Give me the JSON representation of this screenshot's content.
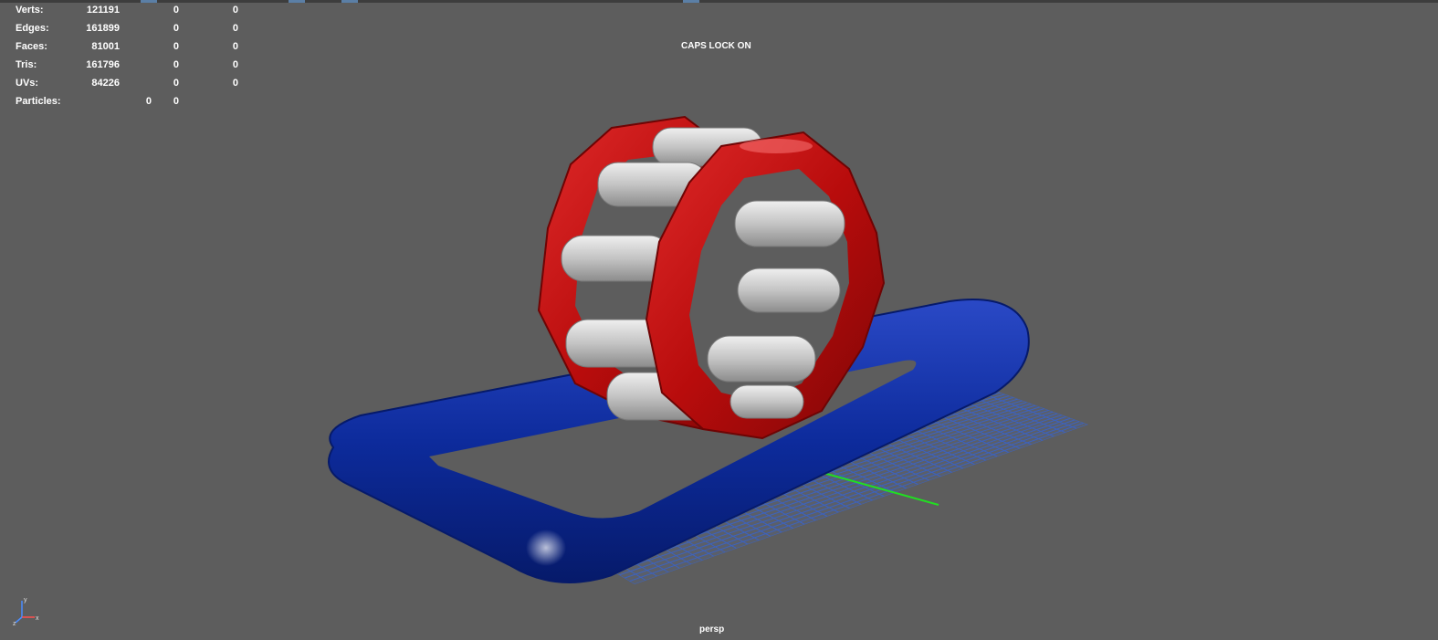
{
  "hud": {
    "stats": [
      {
        "label": "Verts:",
        "values": [
          "121191",
          "0",
          "0"
        ]
      },
      {
        "label": "Edges:",
        "values": [
          "161899",
          "0",
          "0"
        ]
      },
      {
        "label": "Faces:",
        "values": [
          "81001",
          "0",
          "0"
        ]
      },
      {
        "label": "Tris:",
        "values": [
          "161796",
          "0",
          "0"
        ]
      },
      {
        "label": "UVs:",
        "values": [
          "84226",
          "0",
          "0"
        ]
      }
    ],
    "particles": {
      "label": "Particles:",
      "values": [
        "0",
        "0"
      ]
    }
  },
  "caps_lock": "CAPS LOCK ON",
  "camera": "persp",
  "axis_gizmo": {
    "x": "x",
    "y": "y",
    "z": "z"
  },
  "colors": {
    "viewport_bg": "#5d5d5d",
    "grid": "#3a63c8",
    "grid_axis": "#22dd22",
    "pool_blue": "#0b2a9a",
    "wheel_red": "#c40d0d",
    "tube_grey": "#c9c9c9"
  }
}
